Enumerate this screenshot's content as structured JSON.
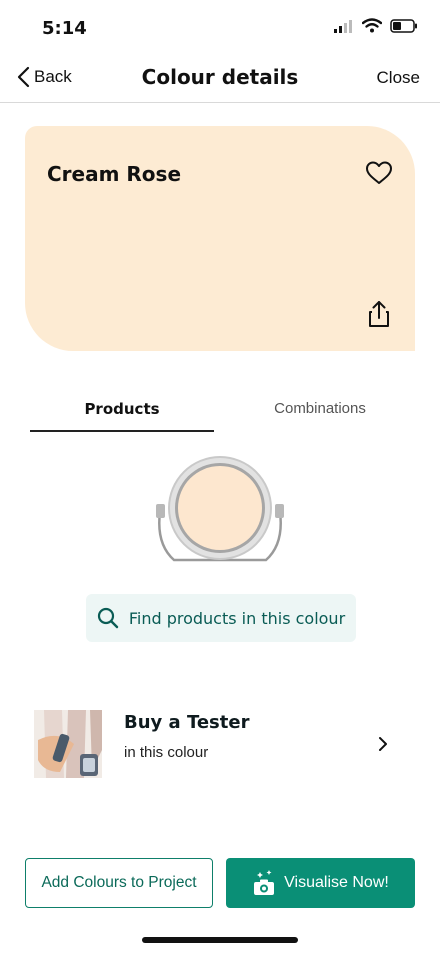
{
  "status_bar": {
    "time": "5:14"
  },
  "nav": {
    "back_label": "Back",
    "title": "Colour details",
    "close_label": "Close"
  },
  "swatch": {
    "name": "Cream Rose",
    "color": "#fdebd3"
  },
  "tabs": [
    {
      "label": "Products",
      "active": true
    },
    {
      "label": "Combinations",
      "active": false
    }
  ],
  "find_products": {
    "label": "Find products in this colour"
  },
  "tester": {
    "title": "Buy a Tester",
    "subtitle": "in this colour"
  },
  "actions": {
    "add_label": "Add Colours to Project",
    "visualise_label": "Visualise Now!"
  },
  "colors": {
    "accent": "#0a8f76",
    "accent_dark": "#0b6a59",
    "find_bg": "#edf6f5"
  },
  "icons": [
    "back-chevron-icon",
    "heart-icon",
    "share-icon",
    "search-icon",
    "chevron-right-icon",
    "camera-sparkle-icon"
  ]
}
